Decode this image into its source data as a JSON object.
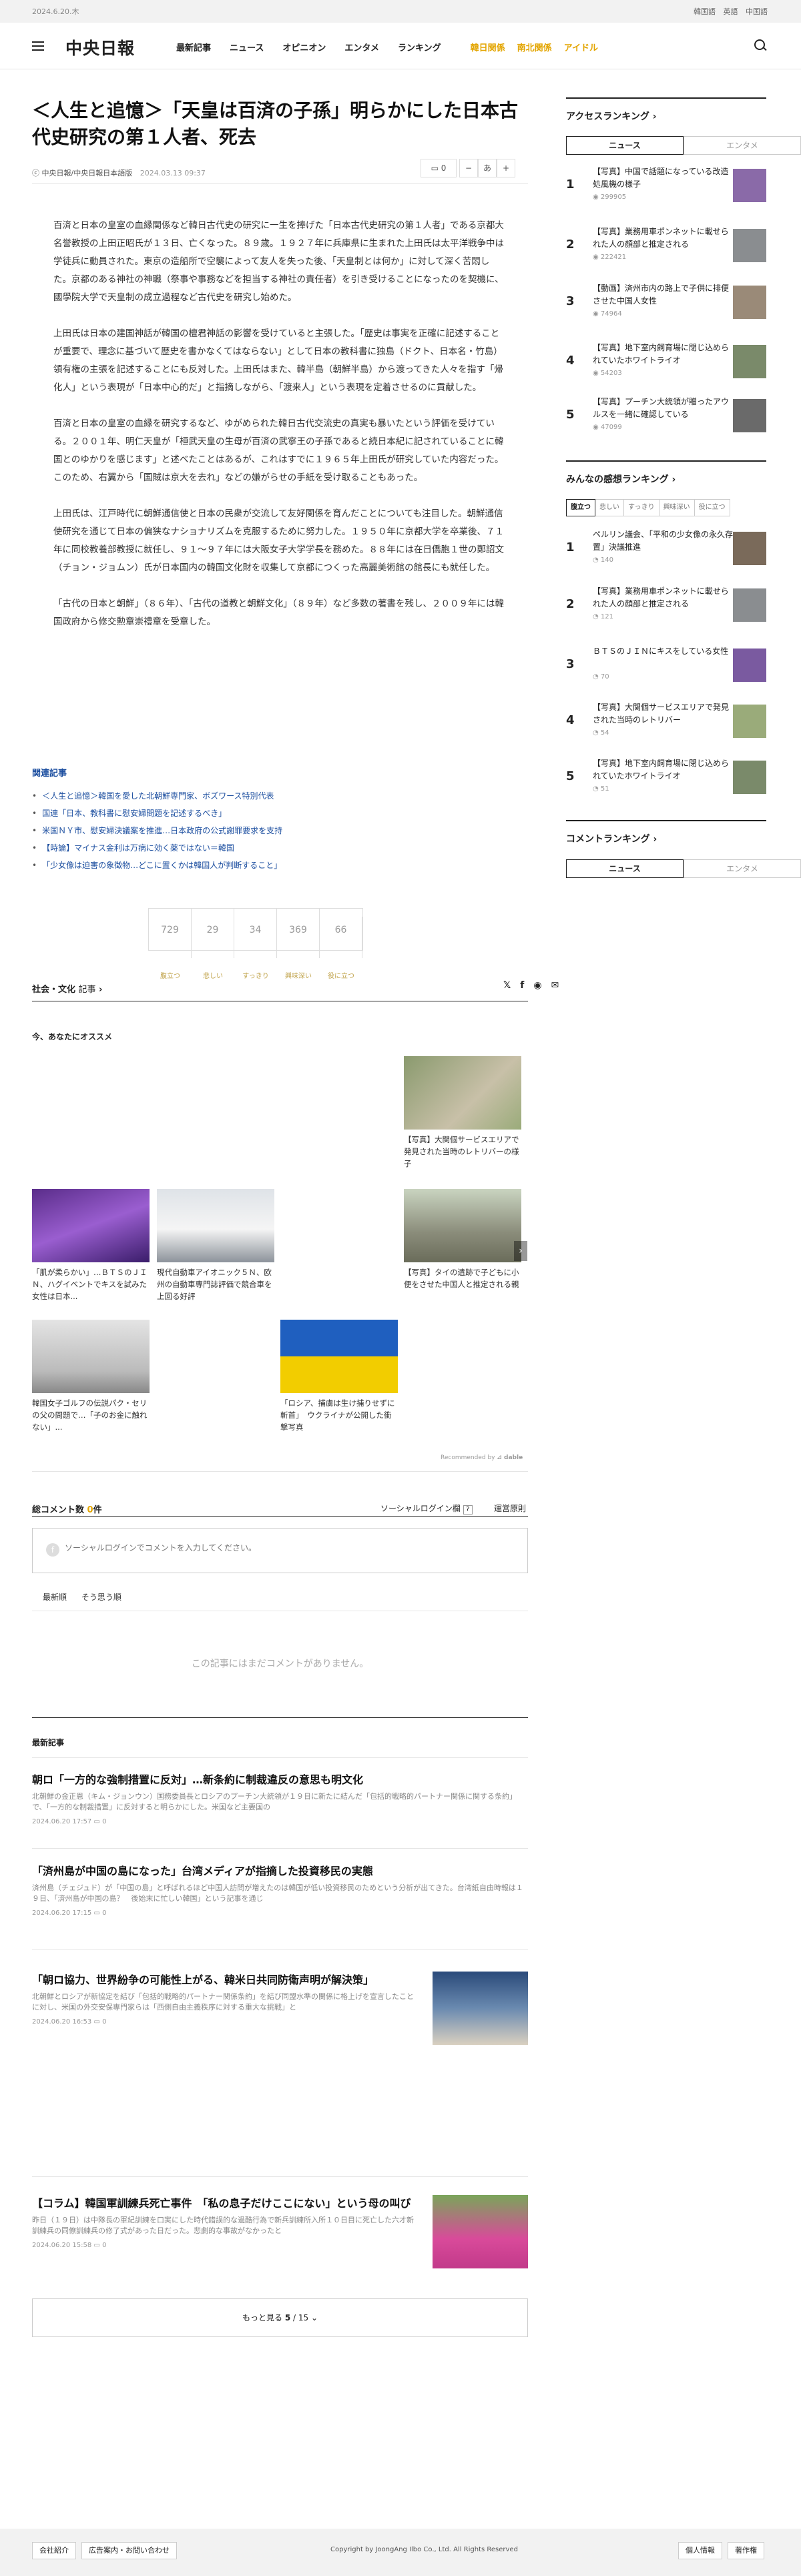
{
  "topbar": {
    "date": "2024.6.20.木",
    "languages": [
      "韓国語",
      "英語",
      "中国語"
    ]
  },
  "header": {
    "logo": "中央日報",
    "nav": [
      "最新記事",
      "ニュース",
      "オピニオン",
      "エンタメ",
      "ランキング"
    ],
    "nav_highlight": [
      "韓日関係",
      "南北関係",
      "アイドル"
    ]
  },
  "article": {
    "title": "＜人生と追憶＞「天皇は百済の子孫」明らかにした日本古代史研究の第１人者、死去",
    "byline": "中央日報/中央日報日本語版",
    "time": "2024.03.13 09:37",
    "comment_count": "0",
    "font_label": "あ",
    "paragraphs": [
      "百済と日本の皇室の血縁関係など韓日古代史の研究に一生を捧げた「日本古代史研究の第１人者」である京都大名誉教授の上田正昭氏が１３日、亡くなった。８９歳。１９２７年に兵庫県に生まれた上田氏は太平洋戦争中は学徒兵に動員された。東京の造船所で空襲によって友人を失った後、「天皇制とは何か」に対して深く苦悶した。京都のある神社の神職（祭事や事務などを担当する神社の責任者）を引き受けることになったのを契機に、國學院大学で天皇制の成立過程など古代史を研究し始めた。",
      "上田氏は日本の建国神話が韓国の檀君神話の影響を受けていると主張した。「歴史は事実を正確に記述することが重要で、理念に基づいて歴史を書かなくてはならない」として日本の教科書に独島（ドクト、日本名・竹島）領有権の主張を記述することにも反対した。上田氏はまた、韓半島（朝鮮半島）から渡ってきた人々を指す「帰化人」という表現が「日本中心的だ」と指摘しながら、「渡来人」という表現を定着させるのに貢献した。",
      "百済と日本の皇室の血縁を研究するなど、ゆがめられた韓日古代交流史の真実も暴いたという評価を受けている。２００１年、明仁天皇が「桓武天皇の生母が百済の武寧王の子孫であると続日本紀に記されていることに韓国とのゆかりを感じます」と述べたことはあるが、これはすでに１９６５年上田氏が研究していた内容だった。このため、右翼から「国賊は京大を去れ」などの嫌がらせの手紙を受け取ることもあった。",
      "上田氏は、江戸時代に朝鮮通信使と日本の民衆が交流して友好関係を育んだことについても注目した。朝鮮通信使研究を通じて日本の偏狭なナショナリズムを克服するために努力した。１９５０年に京都大学を卒業後、７１年に同校教養部教授に就任し、９１～９７年には大阪女子大学学長を務めた。８８年には在日僑胞１世の鄭詔文（チョン・ジョムン）氏が日本国内の韓国文化財を収集して京都につくった高麗美術館の館長にも就任した。",
      "「古代の日本と朝鮮」（８６年）、「古代の道教と朝鮮文化」（８９年）など多数の著書を残し、２００９年には韓国政府から修交勲章崇禮章を受章した。"
    ]
  },
  "related": {
    "title": "関連記事",
    "items": [
      "＜人生と追憶＞韓国を愛した北朝鮮専門家、ボズワース特別代表",
      "国連「日本、教科書に慰安婦問題を記述するべき」",
      "米国ＮＹ市、慰安婦決議案を推進…日本政府の公式謝罪要求を支持",
      "【時論】マイナス金利は万病に効く薬ではない＝韓国",
      "「少女像は迫害の象徴物…どこに置くかは韓国人が判断すること」"
    ]
  },
  "reactions": [
    {
      "count": "729",
      "label": "腹立つ"
    },
    {
      "count": "29",
      "label": "悲しい"
    },
    {
      "count": "34",
      "label": "すっきり"
    },
    {
      "count": "369",
      "label": "興味深い"
    },
    {
      "count": "66",
      "label": "役に立つ"
    }
  ],
  "category": {
    "label": "社会・文化",
    "suffix": "記事"
  },
  "share_icons": [
    "x-icon",
    "facebook-icon",
    "line-icon",
    "mail-icon"
  ],
  "reco": {
    "title": "今、あなたにオススメ",
    "powered": "Recommended by",
    "items": [
      "【写真】大関個サービスエリアで発見された当時のレトリバーの様子",
      "「肌が柔らかい」…ＢＴＳのＪＩＮ、ハグイベントでキスを試みた女性は日本...",
      "現代自動車アイオニック５Ｎ、欧州の自動車専門誌評価で競合車を上回る好評",
      "【写真】タイの遺跡で子どもに小便をさせた中国人と推定される親",
      "韓国女子ゴルフの伝説パク・セリの父の問題で…「子のお金に触れない」...",
      "「ロシア、捕虜は生け捕りせずに斬首」　ウクライナが公開した衝撃写真"
    ]
  },
  "comments": {
    "title_prefix": "総コメント数",
    "count": "0",
    "title_suffix": "件",
    "login": "ソーシャルログイン欄",
    "rules": "運営原則",
    "placeholder": "ソーシャルログインでコメントを入力してください。",
    "sort": [
      "最新順",
      "そう思う順"
    ],
    "empty": "この記事にはまだコメントがありません。"
  },
  "latest": {
    "title": "最新記事",
    "items": [
      {
        "title": "朝ロ「一方的な強制措置に反対」…新条約に制裁違反の意思も明文化",
        "summary": "北朝鮮の金正恩（キム・ジョンウン）国務委員長とロシアのプーチン大統領が１９日に新たに結んだ「包括的戦略的パートナー関係に関する条約」で、「一方的な制裁措置」に反対すると明らかにした。米国など主要国の",
        "time": "2024.06.20 17:57"
      },
      {
        "title": "「済州島が中国の島になった」台湾メディアが指摘した投資移民の実態",
        "summary": "済州島（チェジュド）が「中国の島」と呼ばれるほど中国人訪問が増えたのは韓国が低い投資移民のためという分析が出てきた。台湾紙自由時報は１９日、「済州島が中国の島？　後始末に忙しい韓国」という記事を通じ",
        "time": "2024.06.20 17:15"
      },
      {
        "title": "「朝ロ協力、世界紛争の可能性上がる、韓米日共同防衛声明が解決策」",
        "summary": "北朝鮮とロシアが新協定を結び「包括的戦略的パートナー関係条約」を結び同盟水準の関係に格上げを宣言したことに対し、米国の外交安保専門家らは「西側自由主義秩序に対する重大な挑戦」と",
        "time": "2024.06.20 16:53"
      },
      {
        "title": "【コラム】韓国軍訓練兵死亡事件　「私の息子だけここにない」という母の叫び",
        "summary": "昨日（１９日）は中隊長の軍紀訓練を口実にした時代錯誤的な過酷行為で新兵訓練所入所１０日目に死亡した六才新訓練兵の同僚訓練兵の修了式があった日だった。悲劇的な事故がなかったと",
        "time": "2024.06.20 15:58"
      }
    ]
  },
  "more": {
    "label_prefix": "もっと見る",
    "page": "5",
    "total": "15"
  },
  "footer": {
    "company": "会社紹介",
    "ads": "広告案内・お問い合わせ",
    "copyright": "Copyright by JoongAng Ilbo Co., Ltd. All Rights Reserved",
    "privacy": "個人情報",
    "copyright_btn": "著作権"
  },
  "sidebar": {
    "access": {
      "title": "アクセスランキング",
      "tabs": [
        "ニュース",
        "エンタメ"
      ],
      "items": [
        {
          "num": "1",
          "title": "【写真】中国で話題になっている改造処風機の様子",
          "views": "299905"
        },
        {
          "num": "2",
          "title": "【写真】業務用車ポンネットに載せられた人の顔部と推定される",
          "views": "222421"
        },
        {
          "num": "3",
          "title": "【動画】済州市内の路上で子供に排便させた中国人女性",
          "views": "74964"
        },
        {
          "num": "4",
          "title": "【写真】地下室内飼育場に閉じ込められていたホワイトライオ",
          "views": "54203"
        },
        {
          "num": "5",
          "title": "【写真】プーチン大統領が贈ったアウルスを一緒に確認している",
          "views": "47099"
        }
      ]
    },
    "emotion": {
      "title": "みんなの感想ランキング",
      "tabs": [
        "腹立つ",
        "悲しい",
        "すっきり",
        "興味深い",
        "役に立つ"
      ],
      "items": [
        {
          "num": "1",
          "title": "ペルリン議会、「平和の少女像の永久存置」決議推進",
          "views": "140"
        },
        {
          "num": "2",
          "title": "【写真】業務用車ポンネットに載せられた人の顔部と推定される",
          "views": "121"
        },
        {
          "num": "3",
          "title": "ＢＴＳのＪＩＮにキスをしている女性",
          "views": "70"
        },
        {
          "num": "4",
          "title": "【写真】大関個サービスエリアで発見された当時のレトリバー",
          "views": "54"
        },
        {
          "num": "5",
          "title": "【写真】地下室内飼育場に閉じ込められていたホワイトライオ",
          "views": "51"
        }
      ]
    },
    "comment": {
      "title": "コメントランキング",
      "tabs": [
        "ニュース",
        "エンタメ"
      ]
    }
  }
}
